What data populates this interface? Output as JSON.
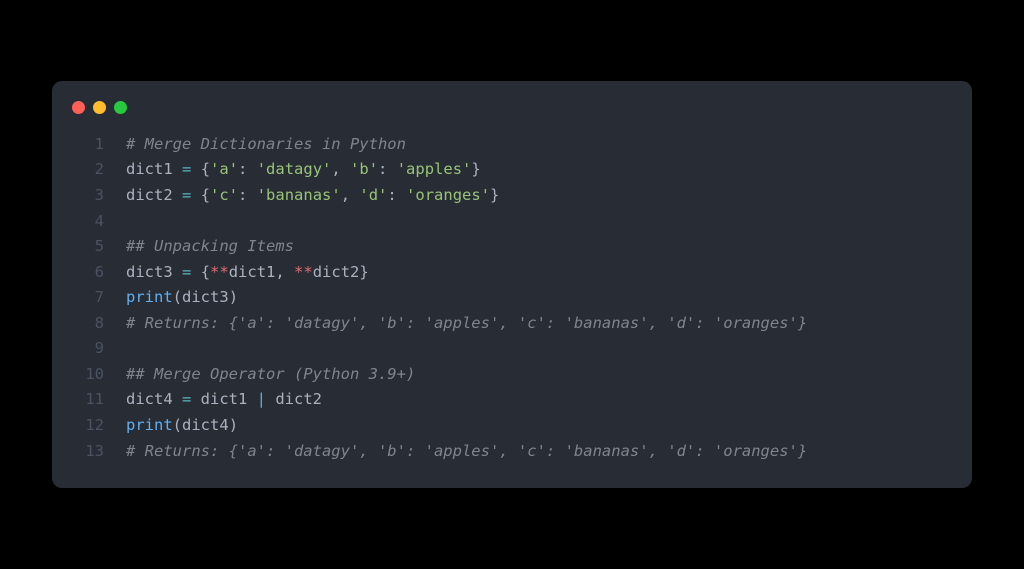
{
  "window": {
    "dots": [
      "red",
      "yellow",
      "green"
    ]
  },
  "code": {
    "lines": [
      {
        "n": "1",
        "tokens": [
          {
            "cls": "c-comment",
            "t": "# Merge Dictionaries in Python"
          }
        ]
      },
      {
        "n": "2",
        "tokens": [
          {
            "cls": "c-plain",
            "t": "dict1 "
          },
          {
            "cls": "c-op",
            "t": "="
          },
          {
            "cls": "c-plain",
            "t": " "
          },
          {
            "cls": "c-punct",
            "t": "{"
          },
          {
            "cls": "c-str",
            "t": "'a'"
          },
          {
            "cls": "c-punct",
            "t": ": "
          },
          {
            "cls": "c-str",
            "t": "'datagy'"
          },
          {
            "cls": "c-punct",
            "t": ", "
          },
          {
            "cls": "c-str",
            "t": "'b'"
          },
          {
            "cls": "c-punct",
            "t": ": "
          },
          {
            "cls": "c-str",
            "t": "'apples'"
          },
          {
            "cls": "c-punct",
            "t": "}"
          }
        ]
      },
      {
        "n": "3",
        "tokens": [
          {
            "cls": "c-plain",
            "t": "dict2 "
          },
          {
            "cls": "c-op",
            "t": "="
          },
          {
            "cls": "c-plain",
            "t": " "
          },
          {
            "cls": "c-punct",
            "t": "{"
          },
          {
            "cls": "c-str",
            "t": "'c'"
          },
          {
            "cls": "c-punct",
            "t": ": "
          },
          {
            "cls": "c-str",
            "t": "'bananas'"
          },
          {
            "cls": "c-punct",
            "t": ", "
          },
          {
            "cls": "c-str",
            "t": "'d'"
          },
          {
            "cls": "c-punct",
            "t": ": "
          },
          {
            "cls": "c-str",
            "t": "'oranges'"
          },
          {
            "cls": "c-punct",
            "t": "}"
          }
        ]
      },
      {
        "n": "4",
        "tokens": []
      },
      {
        "n": "5",
        "tokens": [
          {
            "cls": "c-comment",
            "t": "## Unpacking Items"
          }
        ]
      },
      {
        "n": "6",
        "tokens": [
          {
            "cls": "c-plain",
            "t": "dict3 "
          },
          {
            "cls": "c-op",
            "t": "="
          },
          {
            "cls": "c-plain",
            "t": " "
          },
          {
            "cls": "c-punct",
            "t": "{"
          },
          {
            "cls": "c-star",
            "t": "**"
          },
          {
            "cls": "c-plain",
            "t": "dict1"
          },
          {
            "cls": "c-punct",
            "t": ", "
          },
          {
            "cls": "c-star",
            "t": "**"
          },
          {
            "cls": "c-plain",
            "t": "dict2"
          },
          {
            "cls": "c-punct",
            "t": "}"
          }
        ]
      },
      {
        "n": "7",
        "tokens": [
          {
            "cls": "c-fn",
            "t": "print"
          },
          {
            "cls": "c-punct",
            "t": "("
          },
          {
            "cls": "c-plain",
            "t": "dict3"
          },
          {
            "cls": "c-punct",
            "t": ")"
          }
        ]
      },
      {
        "n": "8",
        "tokens": [
          {
            "cls": "c-comment",
            "t": "# Returns: {'a': 'datagy', 'b': 'apples', 'c': 'bananas', 'd': 'oranges'}"
          }
        ]
      },
      {
        "n": "9",
        "tokens": []
      },
      {
        "n": "10",
        "tokens": [
          {
            "cls": "c-comment",
            "t": "## Merge Operator (Python 3.9+)"
          }
        ]
      },
      {
        "n": "11",
        "tokens": [
          {
            "cls": "c-plain",
            "t": "dict4 "
          },
          {
            "cls": "c-op",
            "t": "="
          },
          {
            "cls": "c-plain",
            "t": " dict1 "
          },
          {
            "cls": "c-op",
            "t": "|"
          },
          {
            "cls": "c-plain",
            "t": " dict2"
          }
        ]
      },
      {
        "n": "12",
        "tokens": [
          {
            "cls": "c-fn",
            "t": "print"
          },
          {
            "cls": "c-punct",
            "t": "("
          },
          {
            "cls": "c-plain",
            "t": "dict4"
          },
          {
            "cls": "c-punct",
            "t": ")"
          }
        ]
      },
      {
        "n": "13",
        "tokens": [
          {
            "cls": "c-comment",
            "t": "# Returns: {'a': 'datagy', 'b': 'apples', 'c': 'bananas', 'd': 'oranges'}"
          }
        ]
      }
    ]
  }
}
